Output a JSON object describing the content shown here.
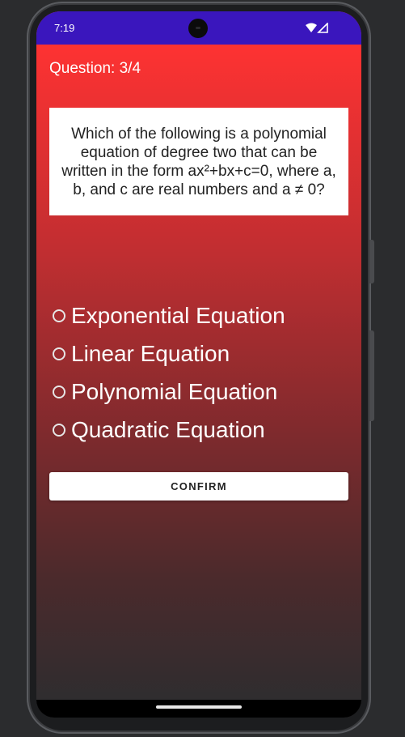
{
  "status_bar": {
    "time": "7:19",
    "icons": [
      "wifi-icon",
      "cellular-signal-icon"
    ]
  },
  "quiz": {
    "counter": "Question: 3/4",
    "question": "Which of the following is a polynomial equation of degree two that can be written in the form ax²+bx+c=0, where a, b, and c are real numbers and a ≠ 0?",
    "options": [
      "Exponential Equation",
      "Linear Equation",
      "Polynomial Equation",
      "Quadratic Equation"
    ],
    "selected_option": null,
    "confirm_label": "CONFIRM"
  },
  "colors": {
    "status_bar": "#3a16bd",
    "gradient_top": "#fe3232",
    "gradient_bottom": "#2f2d2f"
  }
}
